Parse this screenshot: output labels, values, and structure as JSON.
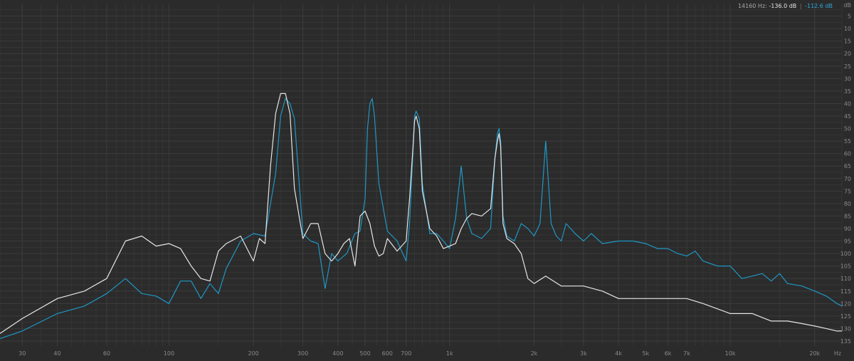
{
  "readout": {
    "freq": "14160 Hz:",
    "white_db": "-136.0 dB",
    "separator": "|",
    "blue_db": "-112.6 dB"
  },
  "colors": {
    "background": "#2b2b2b",
    "grid_major": "#3c3c3c",
    "grid_minor": "#353535",
    "label": "#8a8a8a",
    "series_blue": "#1f97c4",
    "series_white": "#e6e6e6"
  },
  "chart_data": {
    "type": "line",
    "x_scale": "log",
    "xlim": [
      25,
      25000
    ],
    "ylim": [
      0,
      137
    ],
    "y_inverted": true,
    "grid": true,
    "x_tick_labels": [
      "30",
      "40",
      "60",
      "100",
      "200",
      "300",
      "400",
      "500",
      "600",
      "700",
      "1k",
      "2k",
      "3k",
      "4k",
      "5k",
      "6k",
      "7k",
      "10k",
      "20k",
      "Hz"
    ],
    "x_tick_values": [
      30,
      40,
      60,
      100,
      200,
      300,
      400,
      500,
      600,
      700,
      1000,
      2000,
      3000,
      4000,
      5000,
      6000,
      7000,
      10000,
      20000,
      null
    ],
    "y_tick_labels": [
      "dB",
      "5",
      "10",
      "15",
      "20",
      "25",
      "30",
      "35",
      "40",
      "45",
      "50",
      "55",
      "60",
      "65",
      "70",
      "75",
      "80",
      "85",
      "90",
      "95",
      "100",
      "105",
      "110",
      "115",
      "120",
      "125",
      "130",
      "135"
    ],
    "y_tick_values": [
      0,
      5,
      10,
      15,
      20,
      25,
      30,
      35,
      40,
      45,
      50,
      55,
      60,
      65,
      70,
      75,
      80,
      85,
      90,
      95,
      100,
      105,
      110,
      115,
      120,
      125,
      130,
      135
    ],
    "series": [
      {
        "color": "#1f97c4",
        "x": [
          25,
          30,
          40,
          50,
          60,
          70,
          80,
          90,
          100,
          110,
          120,
          130,
          140,
          150,
          160,
          180,
          200,
          220,
          240,
          250,
          260,
          270,
          280,
          300,
          320,
          340,
          360,
          380,
          400,
          430,
          460,
          480,
          500,
          510,
          520,
          530,
          540,
          560,
          600,
          650,
          700,
          720,
          740,
          750,
          760,
          780,
          800,
          850,
          900,
          950,
          1000,
          1050,
          1100,
          1150,
          1200,
          1300,
          1400,
          1450,
          1480,
          1500,
          1520,
          1550,
          1600,
          1700,
          1800,
          1900,
          2000,
          2100,
          2200,
          2300,
          2400,
          2500,
          2600,
          2800,
          3000,
          3200,
          3500,
          4000,
          4500,
          5000,
          5500,
          6000,
          6500,
          7000,
          7500,
          8000,
          9000,
          10000,
          11000,
          12000,
          13000,
          14000,
          15000,
          16000,
          18000,
          20000,
          22000,
          24000,
          25000
        ],
        "y": [
          134,
          131,
          124,
          121,
          116,
          110,
          116,
          117,
          120,
          111,
          111,
          118,
          112,
          116,
          106,
          95,
          92,
          93,
          68,
          45,
          38,
          40,
          46,
          92,
          95,
          96,
          114,
          100,
          103,
          100,
          92,
          91,
          78,
          50,
          40,
          38,
          45,
          72,
          91,
          95,
          103,
          88,
          60,
          45,
          43,
          46,
          72,
          92,
          92,
          95,
          98,
          86,
          65,
          86,
          92,
          94,
          90,
          62,
          52,
          50,
          55,
          85,
          93,
          95,
          88,
          90,
          93,
          88,
          55,
          88,
          93,
          95,
          88,
          92,
          95,
          92,
          96,
          95,
          95,
          96,
          98,
          98,
          100,
          101,
          99,
          103,
          105,
          105,
          110,
          109,
          108,
          111,
          108,
          112,
          113,
          115,
          117,
          120,
          121
        ]
      },
      {
        "color": "#e6e6e6",
        "x": [
          25,
          30,
          40,
          50,
          60,
          70,
          80,
          90,
          100,
          110,
          120,
          130,
          140,
          150,
          160,
          180,
          200,
          210,
          220,
          230,
          240,
          250,
          260,
          270,
          280,
          300,
          320,
          340,
          360,
          380,
          400,
          420,
          440,
          460,
          480,
          500,
          520,
          540,
          560,
          580,
          600,
          650,
          700,
          720,
          740,
          750,
          760,
          780,
          800,
          850,
          900,
          950,
          1000,
          1050,
          1100,
          1150,
          1200,
          1300,
          1400,
          1450,
          1480,
          1500,
          1520,
          1550,
          1600,
          1700,
          1800,
          1900,
          2000,
          2200,
          2500,
          3000,
          3500,
          4000,
          5000,
          6000,
          7000,
          8000,
          10000,
          12000,
          14000,
          16000,
          18000,
          20000,
          22000,
          24000,
          25000
        ],
        "y": [
          132,
          126,
          118,
          115,
          110,
          95,
          93,
          97,
          96,
          98,
          105,
          110,
          111,
          99,
          96,
          93,
          103,
          94,
          96,
          65,
          44,
          36,
          36,
          44,
          74,
          94,
          88,
          88,
          100,
          103,
          100,
          96,
          94,
          105,
          85,
          83,
          88,
          97,
          101,
          100,
          94,
          99,
          95,
          78,
          58,
          47,
          45,
          50,
          75,
          90,
          93,
          98,
          97,
          96,
          90,
          86,
          84,
          85,
          82,
          62,
          55,
          52,
          57,
          88,
          94,
          96,
          100,
          110,
          112,
          109,
          113,
          113,
          115,
          118,
          118,
          118,
          118,
          120,
          124,
          124,
          127,
          127,
          128,
          129,
          130,
          131,
          131
        ]
      }
    ]
  }
}
